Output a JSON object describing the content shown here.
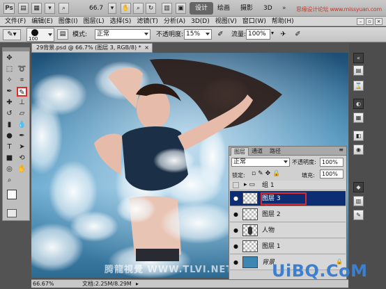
{
  "app": {
    "logo": "Ps",
    "zoom_value": "66.7",
    "workspaces": [
      "设计",
      "绘画",
      "摄影",
      "3D"
    ],
    "watermark_top": "思缘设计论坛 www.missyuan.com"
  },
  "menu": {
    "items": [
      "文件(F)",
      "编辑(E)",
      "图像(I)",
      "图层(L)",
      "选择(S)",
      "滤镜(T)",
      "分析(A)",
      "3D(D)",
      "视图(V)",
      "窗口(W)",
      "帮助(H)"
    ]
  },
  "options": {
    "brush_size": "100",
    "mode_label": "模式:",
    "mode_value": "正常",
    "opacity_label": "不透明度:",
    "opacity_value": "15%",
    "flow_label": "流量:",
    "flow_value": "100%"
  },
  "document": {
    "tab_title": "29背景.psd @ 66.7% (图层 3, RGB/8) *",
    "status_zoom": "66.67%",
    "status_doc": "文档:2.25M/8.29M"
  },
  "layers_panel": {
    "tabs": [
      "图层",
      "通道",
      "路径"
    ],
    "blend_mode": "正常",
    "opacity_label": "不透明度:",
    "opacity_value": "100%",
    "lock_label": "锁定:",
    "fill_label": "填充:",
    "fill_value": "100%",
    "layers": [
      {
        "name": "组 1",
        "kind": "group",
        "visible": false,
        "selected": false
      },
      {
        "name": "图层 3",
        "kind": "layer",
        "visible": true,
        "selected": true
      },
      {
        "name": "图层 2",
        "kind": "layer",
        "visible": true,
        "selected": false
      },
      {
        "name": "人物",
        "kind": "layer",
        "visible": true,
        "selected": false
      },
      {
        "name": "图层 1",
        "kind": "layer",
        "visible": true,
        "selected": false
      },
      {
        "name": "背景",
        "kind": "background",
        "visible": true,
        "selected": false
      }
    ]
  },
  "watermarks": {
    "tlvi": "腾龍視覺 WWW.TLVI.NET",
    "uibq": "UiBQ.CoM"
  },
  "colors": {
    "highlight_red": "#e02a2a",
    "selection_blue": "#0c2c73",
    "uibq_blue": "#3d7fcf"
  }
}
